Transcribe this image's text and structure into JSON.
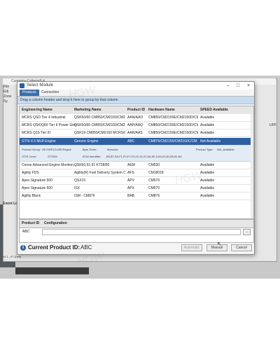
{
  "background": {
    "title": "Cummins Calterm® 4",
    "menu": [
      "File",
      "Edi",
      "Zone",
      "Sy"
    ],
    "status": "v4.1...07  (Dell)",
    "status_left": "Event Lo",
    "right_text": "UPF",
    "watermark": "HGW"
  },
  "dialog": {
    "title": "Select Module",
    "tabs": [
      {
        "label": "Products"
      },
      {
        "label": "Connection"
      }
    ],
    "group_hint": "Drag a column header and drop it here to group by that column",
    "columns": [
      "Engineering Name",
      "Marketing Name",
      "Product ID",
      "Hardware Name",
      "SPEED Available"
    ],
    "rows": [
      {
        "eng": "MCRS QSD Tier 4 Industrial",
        "mkt": "QSK50/60 CM850/CM2150/CM2...",
        "pid": "AAN/AAO",
        "hw": "CM850/CM2150E/CM2150D/CM...",
        "speed": "Available",
        "selected": false
      },
      {
        "eng": "MCRS QSK/Q60 Tier II Power Gen",
        "mkt": "QSK50/60 CM850/CM2150/CM2...",
        "pid": "AAP/AAQ",
        "hw": "CM850/CM2150E/CM2150D/CM...",
        "speed": "Available",
        "selected": false
      },
      {
        "eng": "MCRS Q19 Tier III",
        "mkt": "QSK19 CM850/CM2150 MCRS/Q...",
        "pid": "AAR/AAS",
        "hw": "CM850/CM2150E/CM2150D/CM...",
        "speed": "Available",
        "selected": false
      },
      {
        "eng": "GTIS 4.5 MLB Engine",
        "mkt": "Generic Engine",
        "pid": "ABC",
        "hw": "CM876/CM2150/CM2150C/CM...",
        "speed": "Not Available",
        "selected": true
      }
    ],
    "detail": {
      "product_group_label": "Product Group:",
      "product_group": "HD,HHP,LD,MR,Engine",
      "byte_order_label": "Byte Order:",
      "byte_order": "Motorola",
      "product_type_label": "Product Type:",
      "product_type": "Not_Available",
      "gtis_label": "GTIS Level:",
      "gtis": "GTIS45",
      "ecm_label": "ECM Identifier:",
      "ecm": "B0,B7,D0,F1,F0,F1,F2,0C,01,02,0A,0E,0,0A,00,81,B0,81,B4"
    },
    "rows_after": [
      {
        "eng": "Cense Advanced Engine Monitori...",
        "mkt": "QSK60,91,91 KT38/50",
        "pid": "AEM",
        "hw": "CM530",
        "speed": "Available"
      },
      {
        "eng": "Agility FDS",
        "mkt": "Agility(R) Fuel Delivery System CR...",
        "pid": "AFS",
        "hw": "CM18018",
        "speed": "Available"
      },
      {
        "eng": "Apex Signature 600",
        "mkt": "QSX15",
        "pid": "APV",
        "hw": "CM570",
        "speed": "Available"
      },
      {
        "eng": "Apex Signature 600",
        "mkt": "ISX",
        "pid": "APX",
        "hw": "CM570",
        "speed": "Available"
      },
      {
        "eng": "Agility Black",
        "mkt": "ISM - CM876",
        "pid": "BAB",
        "hw": "CM876",
        "speed": "Available"
      }
    ],
    "config": {
      "columns": [
        "Product ID",
        "Configuration"
      ],
      "product_id": "ABC",
      "value": "",
      "more_label": "..."
    },
    "current_label": "Current Product ID:",
    "current_value": "ABC",
    "buttons": {
      "automatic": "Automatic",
      "manual": "Manual",
      "cancel": "Cancel"
    }
  }
}
